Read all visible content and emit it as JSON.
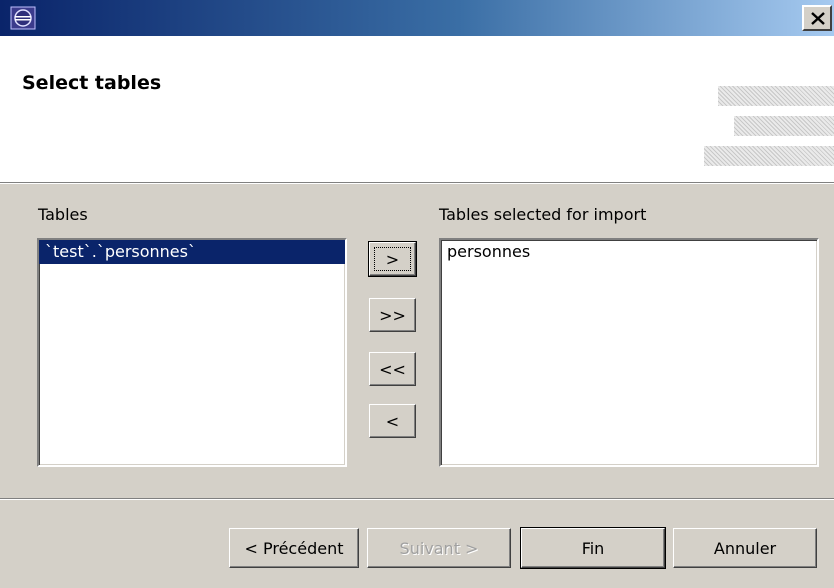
{
  "window": {
    "icon": "eclipse-icon",
    "close_icon": "close-icon"
  },
  "header": {
    "title": "Select tables"
  },
  "left_panel": {
    "label": "Tables",
    "items": [
      "`test`.`personnes`"
    ]
  },
  "right_panel": {
    "label": "Tables selected for import",
    "items": [
      "personnes"
    ]
  },
  "move_buttons": {
    "add": ">",
    "add_all": ">>",
    "remove_all": "<<",
    "remove": "<"
  },
  "footer": {
    "back": "< Précédent",
    "next": "Suivant >",
    "finish": "Fin",
    "cancel": "Annuler"
  },
  "colors": {
    "selection": "#0a246a",
    "dialog_bg": "#d4d0c8"
  }
}
